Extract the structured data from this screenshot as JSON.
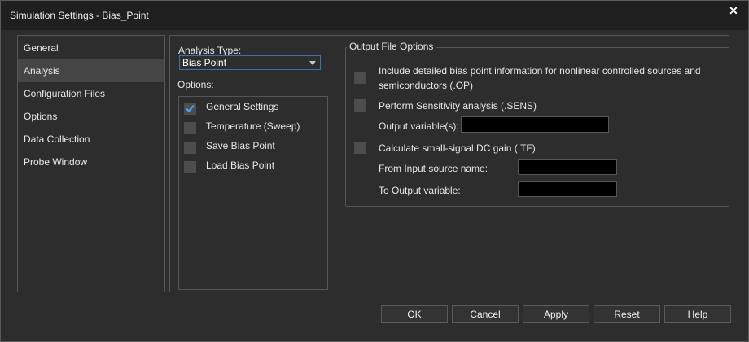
{
  "window": {
    "title": "Simulation Settings - Bias_Point",
    "close_glyph": "✕"
  },
  "sidebar": {
    "items": [
      {
        "label": "General"
      },
      {
        "label": "Analysis",
        "selected": true
      },
      {
        "label": "Configuration Files"
      },
      {
        "label": "Options"
      },
      {
        "label": "Data Collection"
      },
      {
        "label": "Probe Window"
      }
    ]
  },
  "analysis": {
    "type_label": "Analysis Type:",
    "type_value": "Bias Point",
    "options_label": "Options:",
    "options": [
      {
        "label": "General Settings",
        "checked": true
      },
      {
        "label": "Temperature (Sweep)",
        "checked": false
      },
      {
        "label": "Save Bias Point",
        "checked": false
      },
      {
        "label": "Load Bias Point",
        "checked": false
      }
    ]
  },
  "output": {
    "group_title": "Output File Options",
    "op_line1": "Include detailed bias point information for nonlinear controlled sources and",
    "op_line2": "semiconductors (.OP)",
    "sens_label": "Perform Sensitivity analysis (.SENS)",
    "output_vars_label": "Output variable(s):",
    "output_vars_value": "",
    "tf_label": "Calculate small-signal DC gain (.TF)",
    "from_input_label": "From Input source name:",
    "from_input_value": "",
    "to_output_label": "To Output variable:",
    "to_output_value": ""
  },
  "buttons": {
    "ok": "OK",
    "cancel": "Cancel",
    "apply": "Apply",
    "reset": "Reset",
    "help": "Help"
  },
  "colors": {
    "accent": "#3c6fb0",
    "check": "#4aa3ff"
  }
}
